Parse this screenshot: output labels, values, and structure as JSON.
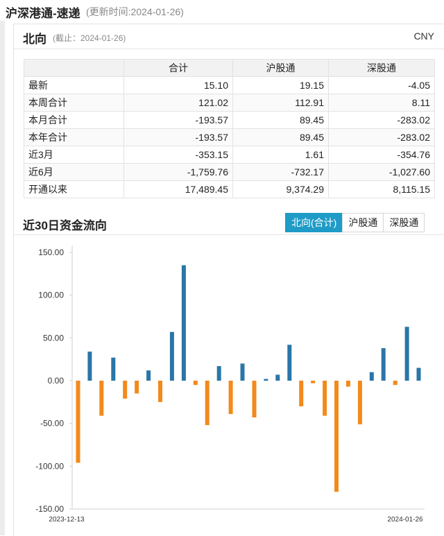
{
  "header": {
    "title": "沪深港通-速递",
    "subtitle": "(更新时间:2024-01-26)"
  },
  "panel": {
    "title": "北向",
    "date": "(截止：2024-01-26)",
    "currency": "CNY"
  },
  "summary": {
    "columns": [
      "",
      "合计",
      "沪股通",
      "深股通"
    ],
    "rows": [
      {
        "label": "最新",
        "values": [
          "15.10",
          "19.15",
          "-4.05"
        ]
      },
      {
        "label": "本周合计",
        "values": [
          "121.02",
          "112.91",
          "8.11"
        ]
      },
      {
        "label": "本月合计",
        "values": [
          "-193.57",
          "89.45",
          "-283.02"
        ]
      },
      {
        "label": "本年合计",
        "values": [
          "-193.57",
          "89.45",
          "-283.02"
        ]
      },
      {
        "label": "近3月",
        "values": [
          "-353.15",
          "1.61",
          "-354.76"
        ]
      },
      {
        "label": "近6月",
        "values": [
          "-1,759.76",
          "-732.17",
          "-1,027.60"
        ]
      },
      {
        "label": "开通以来",
        "values": [
          "17,489.45",
          "9,374.29",
          "8,115.15"
        ]
      }
    ]
  },
  "flow": {
    "title": "近30日资金流向",
    "tabs": [
      {
        "label": "北向(合计)",
        "active": true
      },
      {
        "label": "沪股通",
        "active": false
      },
      {
        "label": "深股通",
        "active": false
      }
    ]
  },
  "chart_data": {
    "type": "bar",
    "x_start_label": "2023-12-13",
    "x_end_label": "2024-01-26",
    "ylim": [
      -150,
      150
    ],
    "yticks": [
      "150.00",
      "100.00",
      "50.00",
      "0.00",
      "-50.00",
      "-100.00",
      "-150.00"
    ],
    "grid": false,
    "positive_color": "#2a76a8",
    "negative_color": "#f28a1c",
    "values": [
      -96,
      34,
      -41,
      27,
      -21,
      -15,
      12,
      -25,
      57,
      135,
      -5,
      -52,
      17,
      -39,
      20,
      -43,
      2,
      7,
      42,
      -30,
      -3,
      -41,
      -130,
      -7,
      -51,
      10,
      38,
      -5,
      63,
      15
    ]
  }
}
